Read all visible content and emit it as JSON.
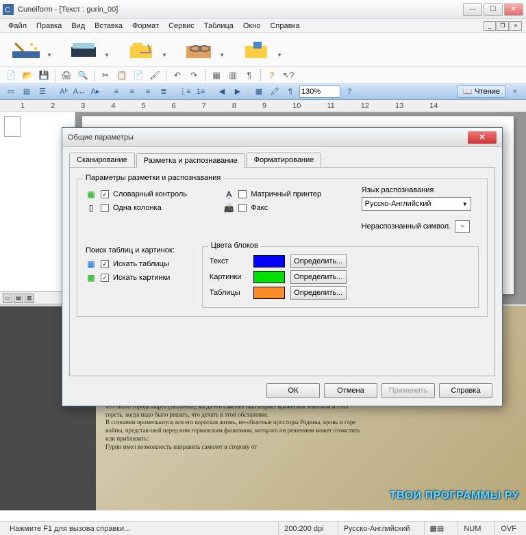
{
  "window": {
    "title": "Cuneiform - [Текст : gurin_00]"
  },
  "menubar": {
    "items": [
      "Файл",
      "Правка",
      "Вид",
      "Вставка",
      "Формат",
      "Сервис",
      "Таблица",
      "Окно",
      "Справка"
    ]
  },
  "zoom": "130%",
  "read_button": "Чтение",
  "ruler_marks": [
    "1",
    "2",
    "3",
    "4",
    "5",
    "6",
    "7",
    "8",
    "9",
    "10",
    "11",
    "12",
    "13",
    "14"
  ],
  "dialog": {
    "title": "Общие параметры",
    "tabs": [
      "Сканирование",
      "Разметка и распознавание",
      "Форматирование"
    ],
    "active_tab": 1,
    "group_title": "Параметры разметки и распознавания",
    "options": {
      "dict_control": "Словарный контроль",
      "one_column": "Одна колонка",
      "matrix_printer": "Матричный принтер",
      "fax": "Факс"
    },
    "lang_label": "Язык распознавания",
    "lang_value": "Русско-Английский",
    "unrec_label": "Нераспознанный символ.",
    "unrec_value": "~",
    "search_label": "Поиск таблиц и картинок:",
    "search_tables": "Искать таблицы",
    "search_pictures": "Искать картинки",
    "colors": {
      "title": "Цвета блоков",
      "text": "Текст",
      "pictures": "Картинки",
      "tables": "Таблицы",
      "text_color": "#0000ff",
      "pictures_color": "#00e000",
      "tables_color": "#ff8c28",
      "define": "Определить..."
    },
    "buttons": {
      "ok": "ОК",
      "cancel": "Отмена",
      "apply": "Применить",
      "help": "Справка"
    }
  },
  "newspaper_text": "В жизни людей бывают такие мгновения, которые кому несут позор, а кому бессмертие.\nУ молодого летчика-штурмовика гвардии младшего лей-тенанта Николая Петровича Гурина такое мгновение было 20 января 1945 года во время штурма железнодорож-ной станции Мацишевице, что около города Варто (Поль-ша), когда его самолет был подбит вражеской зениткой и стал гореть, когда надо было решать, что делать в этой обстановке.\nВ сознании промелькнула вся его короткая жизнь, не-объятные просторы Родины, кровь и горе войны, представ-шей перед ним германским фашизмом, которого он решением может отомстить или приблизить:\nГурин имел возможность направить самолет в сторону от",
  "watermark": "ТВОИ ПРОГРАММЫ РУ",
  "statusbar": {
    "help": "Нажмите F1 для вызова справки...",
    "dpi": "200:200 dpi",
    "lang": "Русско-Английский",
    "num": "NUM",
    "ovf": "OVF"
  }
}
